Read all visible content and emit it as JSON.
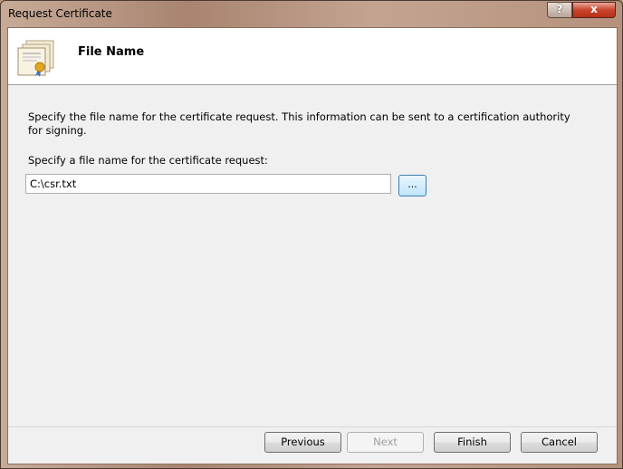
{
  "window": {
    "title": "Request Certificate",
    "help": "?",
    "close": "x"
  },
  "header": {
    "title": "File Name",
    "icon": "certificate-icon"
  },
  "content": {
    "description": "Specify the file name for the certificate request. This information can be sent to a certification authority for signing.",
    "field_label": "Specify a file name for the certificate request:",
    "file_value": "C:\\csr.txt",
    "browse_label": "..."
  },
  "buttons": {
    "previous": "Previous",
    "next": "Next",
    "finish": "Finish",
    "cancel": "Cancel"
  }
}
